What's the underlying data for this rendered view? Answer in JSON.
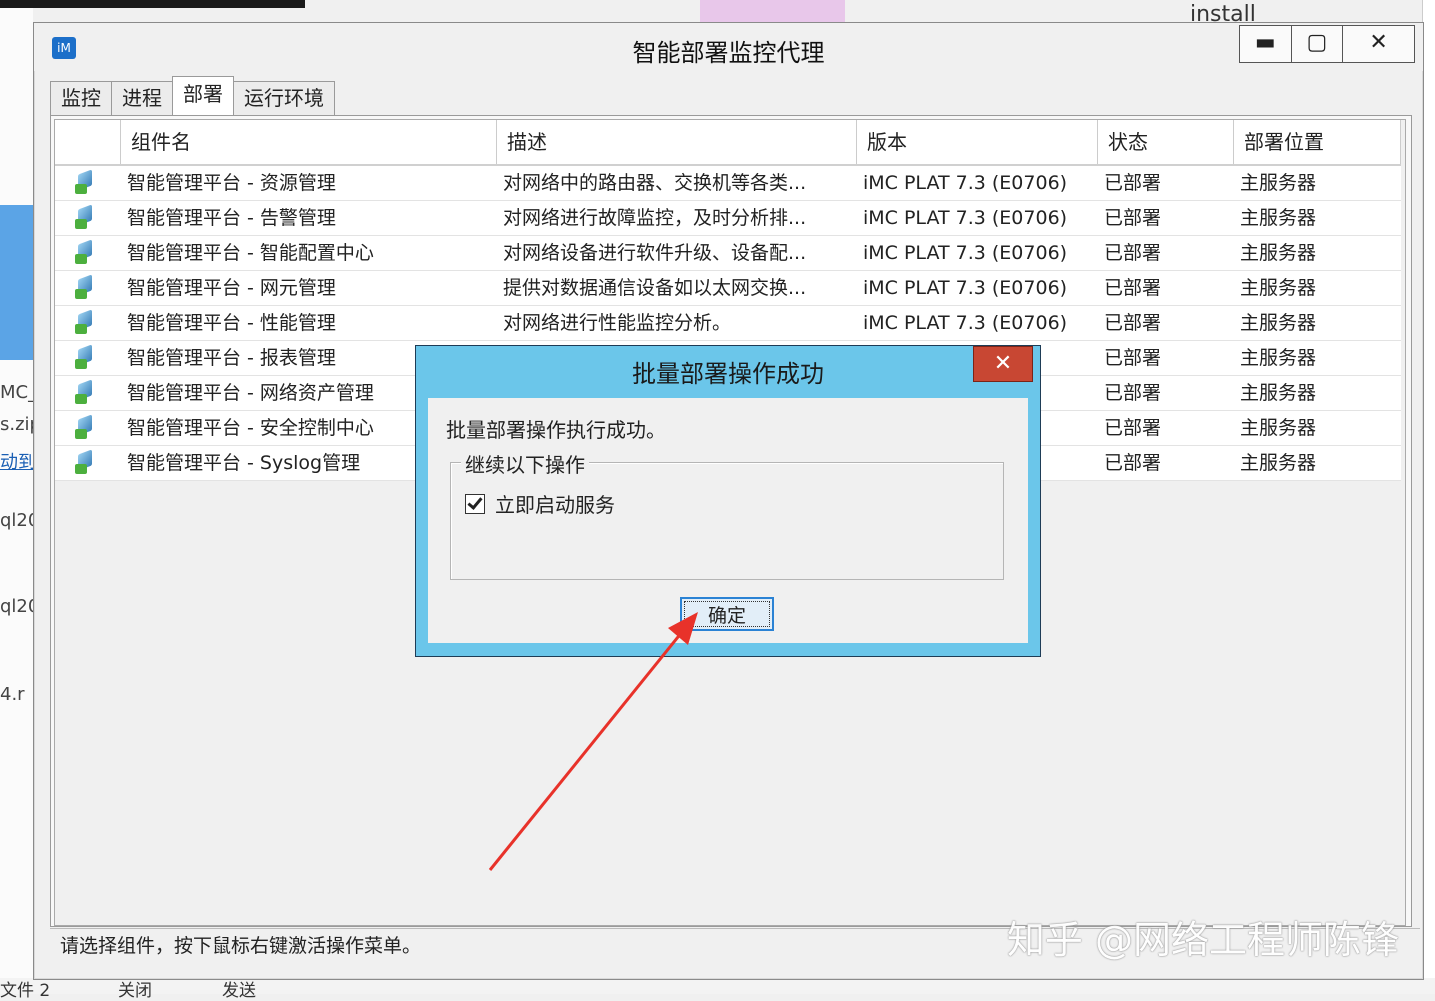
{
  "background": {
    "top_right_text": "install",
    "left_items": [
      "MC_",
      "s.zip",
      "动到",
      "ql20",
      "ql20",
      "4.r"
    ],
    "bottom_items": [
      "文件 2",
      "关闭",
      "发送"
    ]
  },
  "window": {
    "title": "智能部署监控代理",
    "controls": {
      "minimize": "▬",
      "maximize": "▢",
      "close": "✕"
    }
  },
  "tabs": [
    {
      "label": "监控",
      "active": false
    },
    {
      "label": "进程",
      "active": false
    },
    {
      "label": "部署",
      "active": true
    },
    {
      "label": "运行环境",
      "active": false
    }
  ],
  "table": {
    "headers": [
      "",
      "组件名",
      "描述",
      "版本",
      "状态",
      "部署位置"
    ],
    "rows": [
      {
        "name": "智能管理平台 - 资源管理",
        "desc": "对网络中的路由器、交换机等各类...",
        "version": "iMC PLAT 7.3 (E0706)",
        "status": "已部署",
        "location": "主服务器"
      },
      {
        "name": "智能管理平台 - 告警管理",
        "desc": "对网络进行故障监控，及时分析排...",
        "version": "iMC PLAT 7.3 (E0706)",
        "status": "已部署",
        "location": "主服务器"
      },
      {
        "name": "智能管理平台 - 智能配置中心",
        "desc": "对网络设备进行软件升级、设备配...",
        "version": "iMC PLAT 7.3 (E0706)",
        "status": "已部署",
        "location": "主服务器"
      },
      {
        "name": "智能管理平台 - 网元管理",
        "desc": "提供对数据通信设备如以太网交换...",
        "version": "iMC PLAT 7.3 (E0706)",
        "status": "已部署",
        "location": "主服务器"
      },
      {
        "name": "智能管理平台 - 性能管理",
        "desc": "对网络进行性能监控分析。",
        "version": "iMC PLAT 7.3 (E0706)",
        "status": "已部署",
        "location": "主服务器"
      },
      {
        "name": "智能管理平台 - 报表管理",
        "desc": "",
        "version": "06)",
        "status": "已部署",
        "location": "主服务器"
      },
      {
        "name": "智能管理平台 - 网络资产管理",
        "desc": "",
        "version": "06)",
        "status": "已部署",
        "location": "主服务器"
      },
      {
        "name": "智能管理平台 - 安全控制中心",
        "desc": "",
        "version": "06)",
        "status": "已部署",
        "location": "主服务器"
      },
      {
        "name": "智能管理平台 - Syslog管理",
        "desc": "",
        "version": "06)",
        "status": "已部署",
        "location": "主服务器"
      }
    ]
  },
  "statusbar": {
    "text": "请选择组件，按下鼠标右键激活操作菜单。"
  },
  "watermark": "知乎 @网络工程师陈锋",
  "dialog": {
    "title": "批量部署操作成功",
    "close": "✕",
    "message": "批量部署操作执行成功。",
    "group_label": "继续以下操作",
    "checkbox_label": "立即启动服务",
    "checkbox_checked": true,
    "ok_label": "确定"
  },
  "annotation": {
    "arrow_color": "#e8322a"
  }
}
